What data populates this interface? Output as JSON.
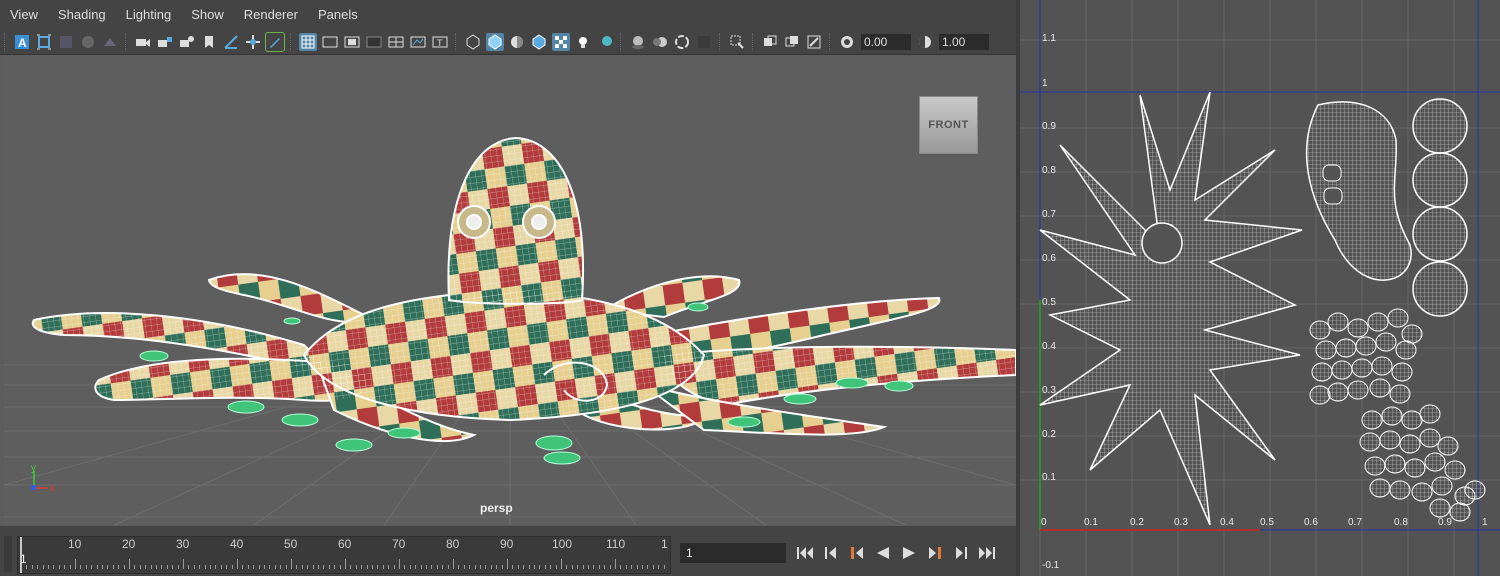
{
  "menu": [
    "View",
    "Shading",
    "Lighting",
    "Show",
    "Renderer",
    "Panels"
  ],
  "toolbar": {
    "exposure_value": "0.00",
    "gamma_value": "1.00"
  },
  "viewport": {
    "view_cube_label": "FRONT",
    "camera_label": "persp",
    "axis_y": "y",
    "axis_x": "x"
  },
  "timeline": {
    "ticks": [
      "10",
      "20",
      "30",
      "40",
      "50",
      "60",
      "70",
      "80",
      "90",
      "100",
      "110",
      "1"
    ],
    "current_frame": "1",
    "frame_field": "1"
  },
  "uv_editor": {
    "y_labels": [
      "1.1",
      "1",
      "0.9",
      "0.8",
      "0.7",
      "0.6",
      "0.5",
      "0.4",
      "0.3",
      "0.2",
      "0.1",
      "-0.1"
    ],
    "x_labels": [
      "0",
      "0.1",
      "0.2",
      "0.3",
      "0.4",
      "0.5",
      "0.6",
      "0.7",
      "0.8",
      "0.9",
      "1"
    ]
  },
  "colors": {
    "viewport_bg": "#5e5e5e",
    "uv_bg": "#535353",
    "grid_line": "#6a6a6a",
    "uv_axis_x": "#b03030",
    "uv_axis_y": "#2f8f2f",
    "uv_frame": "#2233aa",
    "active_button": "#5285a6",
    "suction_cups": "#3fc47a",
    "wire": "#ffffff"
  }
}
